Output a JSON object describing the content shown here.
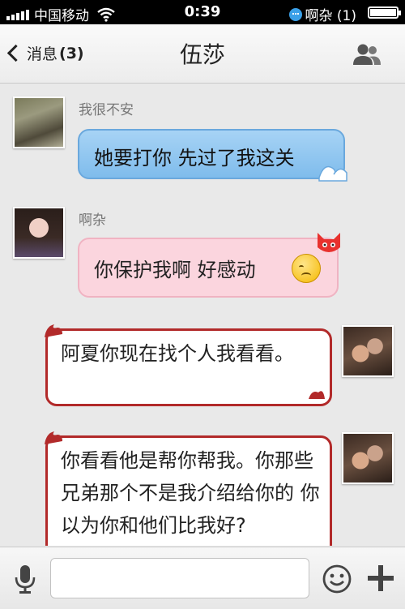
{
  "status_bar": {
    "carrier": "中国移动",
    "time": "0:39",
    "notification": "啊杂 (1)"
  },
  "nav": {
    "back_label": "消息",
    "back_count": "(3)",
    "title": "伍莎"
  },
  "messages": [
    {
      "sender": "我很不安",
      "text": "她要打你 先过了我这关",
      "side": "left",
      "theme": "blue"
    },
    {
      "sender": "啊杂",
      "text": "你保护我啊 好感动",
      "side": "left",
      "theme": "pink"
    },
    {
      "sender": "",
      "text": "阿夏你现在找个人我看看。",
      "side": "right",
      "theme": "white"
    },
    {
      "sender": "",
      "text": "你看看他是帮你帮我。你那些兄弟那个不是我介绍给你的 你以为你和他们比我好?",
      "side": "right",
      "theme": "white"
    }
  ],
  "input": {
    "placeholder": "",
    "value": ""
  },
  "colors": {
    "blue_bubble": "#8cc5ef",
    "pink_bubble": "#fbd5de",
    "white_bubble_border": "#b22a2a"
  }
}
